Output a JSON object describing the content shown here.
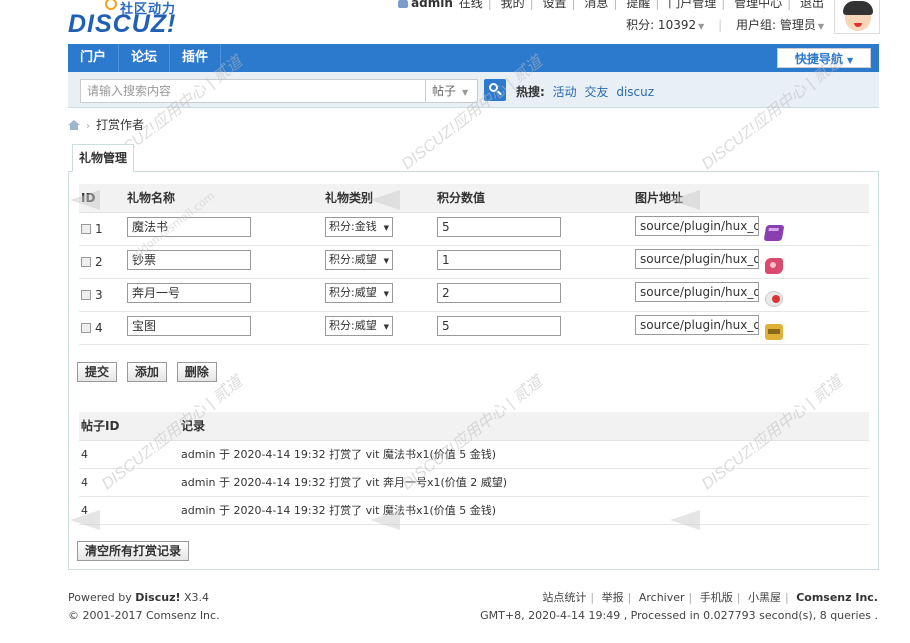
{
  "logo": {
    "sub": "社区动力",
    "main": "DISCUZ!"
  },
  "topnav": {
    "username": "admin",
    "items": [
      "在线",
      "我的",
      "设置",
      "消息",
      "提醒",
      "门户管理",
      "管理中心",
      "退出"
    ]
  },
  "userinfo": {
    "credits": "积分: 10392",
    "group": "用户组: 管理员"
  },
  "navbar": {
    "items": [
      "门户",
      "论坛",
      "插件"
    ],
    "quicknav": "快捷导航"
  },
  "search": {
    "placeholder": "请输入搜索内容",
    "type": "帖子",
    "hot_label": "热搜:",
    "hot_words": [
      "活动",
      "交友",
      "discuz"
    ]
  },
  "breadcrumb": {
    "current": "打赏作者"
  },
  "tab": {
    "label": "礼物管理"
  },
  "gift_table": {
    "headers": [
      "ID",
      "礼物名称",
      "礼物类别",
      "积分数值",
      "图片地址"
    ],
    "rows": [
      {
        "id": "1",
        "name": "魔法书",
        "category": "积分:金钱",
        "value": "5",
        "image": "source/plugin/hux_dashang",
        "icon": "book-icon"
      },
      {
        "id": "2",
        "name": "钞票",
        "category": "积分:威望",
        "value": "1",
        "image": "source/plugin/hux_dashang",
        "icon": "money-icon"
      },
      {
        "id": "3",
        "name": "奔月一号",
        "category": "积分:威望",
        "value": "2",
        "image": "source/plugin/hux_dashang",
        "icon": "moon-icon"
      },
      {
        "id": "4",
        "name": "宝图",
        "category": "积分:威望",
        "value": "5",
        "image": "source/plugin/hux_dashang",
        "icon": "map-icon"
      }
    ]
  },
  "buttons": {
    "submit": "提交",
    "add": "添加",
    "delete": "删除",
    "clear": "清空所有打赏记录"
  },
  "records": {
    "headers": [
      "帖子ID",
      "记录"
    ],
    "rows": [
      {
        "tid": "4",
        "text": "admin 于 2020-4-14 19:32 打赏了 vit 魔法书x1(价值 5 金钱)"
      },
      {
        "tid": "4",
        "text": "admin 于 2020-4-14 19:32 打赏了 vit 奔月一号x1(价值 2 威望)"
      },
      {
        "tid": "4",
        "text": "admin 于 2020-4-14 19:32 打赏了 vit 魔法书x1(价值 5 金钱)"
      }
    ]
  },
  "footer": {
    "powered_prefix": "Powered by",
    "powered_brand": "Discuz!",
    "version": "X3.4",
    "copyright": "© 2001-2017 Comsenz Inc.",
    "links": [
      "站点统计",
      "举报",
      "Archiver",
      "手机版",
      "小黑屋"
    ],
    "company": "Comsenz Inc.",
    "stats": "GMT+8, 2020-4-14 19:49 , Processed in 0.027793 second(s), 8 queries ."
  },
  "watermark": {
    "text": "DISCUZ!应用中心 | 贰道",
    "sub": "addon.dismall.com"
  }
}
